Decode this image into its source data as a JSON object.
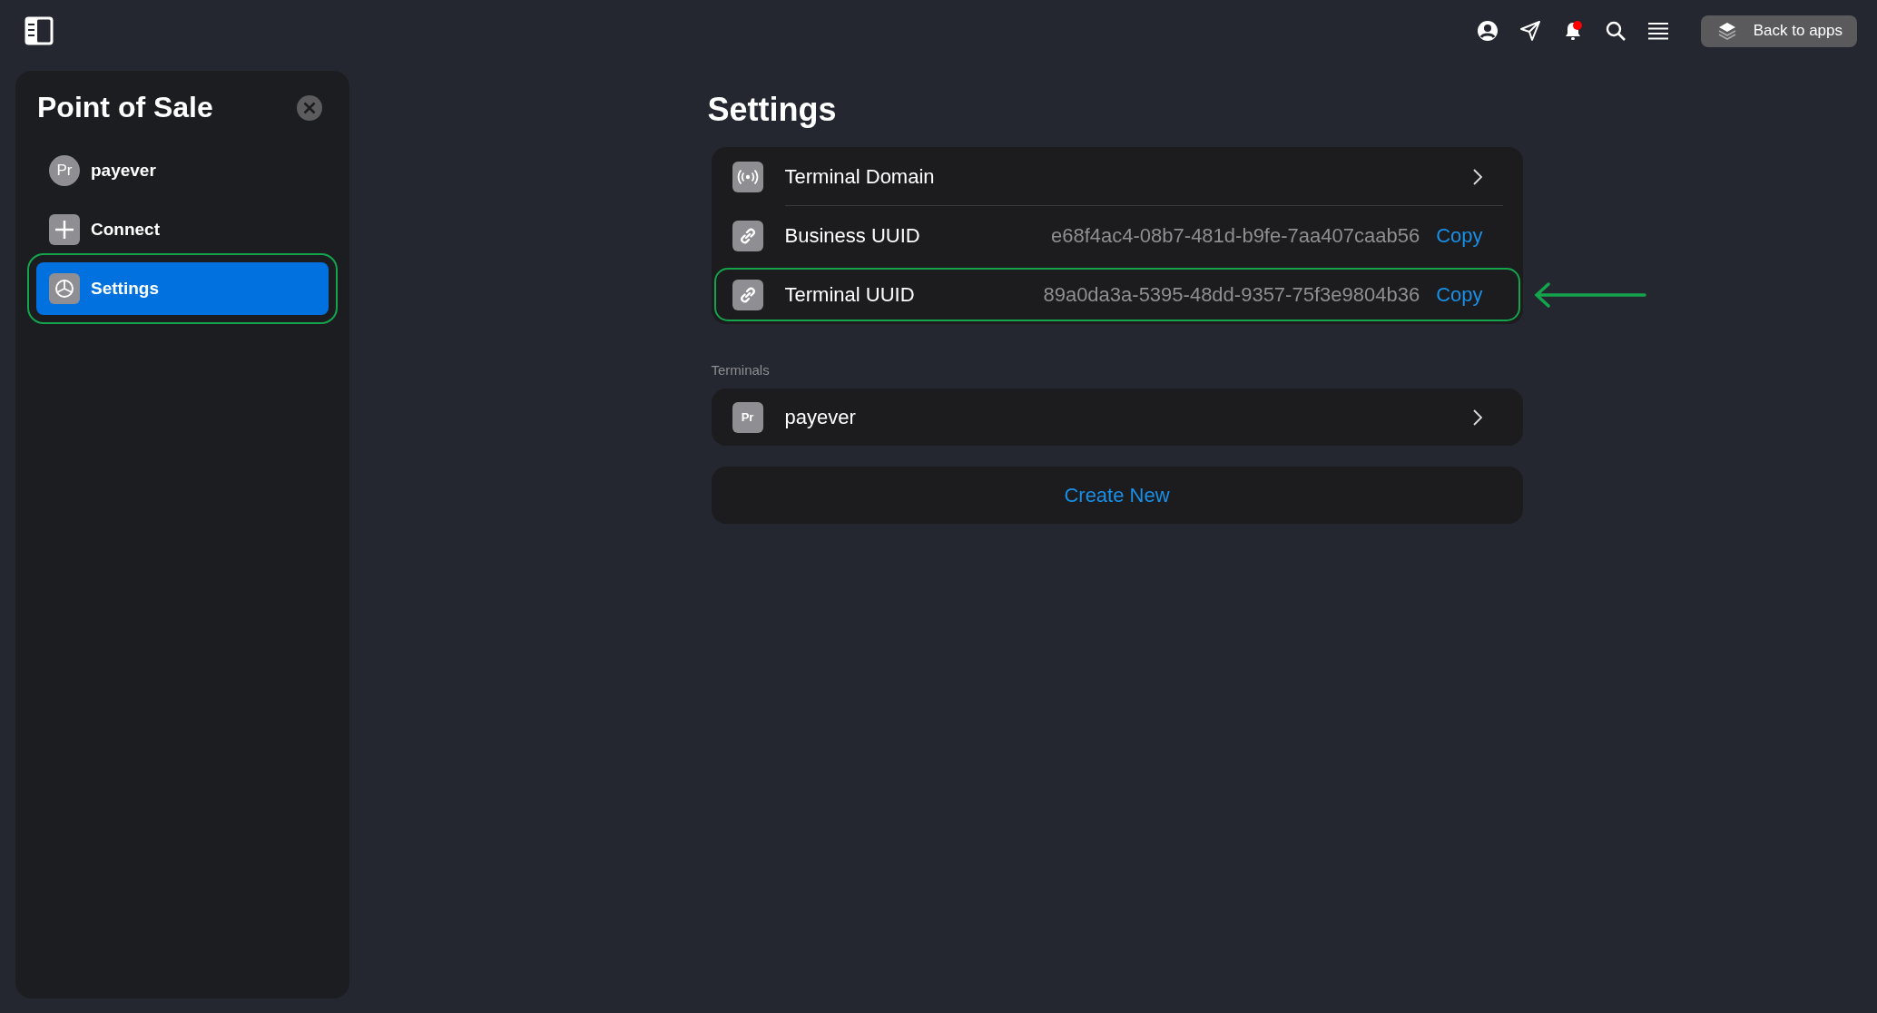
{
  "top_bar": {
    "has_unread": true,
    "back_button": "Back to apps"
  },
  "sidebar": {
    "title": "Point of Sale",
    "items": [
      {
        "kind": "avatar",
        "avatar_text": "Pr",
        "label": "payever",
        "selected": false,
        "highlighted": false
      },
      {
        "kind": "add",
        "label": "Connect",
        "selected": false,
        "highlighted": false
      },
      {
        "kind": "settings",
        "label": "Settings",
        "selected": true,
        "highlighted": true
      }
    ]
  },
  "settings": {
    "title": "Settings",
    "rows": [
      {
        "kind": "domain",
        "label": "Terminal Domain",
        "highlighted": false
      },
      {
        "kind": "uuid",
        "label": "Business UUID",
        "value": "e68f4ac4-08b7-481d-b9fe-7aa407caab56",
        "action": "Copy",
        "highlighted": false
      },
      {
        "kind": "uuid",
        "label": "Terminal UUID",
        "value": "89a0da3a-5395-48dd-9357-75f3e9804b36",
        "action": "Copy",
        "highlighted": true
      }
    ]
  },
  "terminals": {
    "label": "Terminals",
    "items": [
      {
        "avatar_text": "Pr",
        "name": "payever"
      }
    ]
  },
  "create_button": "Create New"
}
